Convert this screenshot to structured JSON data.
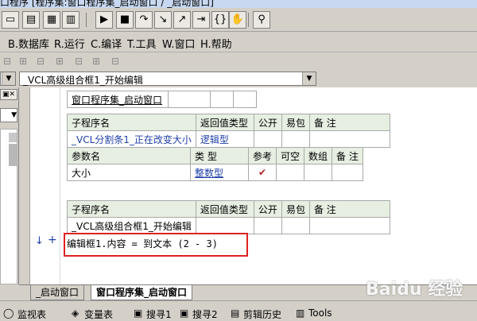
{
  "titlebar": {
    "text": "口程序 [程序集:窗口程序集_启动窗口 / _启动窗口]"
  },
  "menubar": {
    "items": [
      "B.数据库",
      "R.运行",
      "C.编译",
      "T.工具",
      "W.窗口",
      "H.帮助"
    ]
  },
  "combo": {
    "left_value": "",
    "right_value": "_VCL高级组合框1_开始编辑"
  },
  "table1": {
    "cells": [
      "窗口程序集_启动窗口",
      "",
      "",
      ""
    ]
  },
  "table2": {
    "header": [
      "子程序名",
      "返回值类型",
      "公开",
      "易包",
      "备 注"
    ],
    "row": [
      "_VCL分割条1_正在改变大小",
      "逻辑型",
      "",
      "",
      ""
    ],
    "param_header": [
      "参数名",
      "类 型",
      "参考",
      "可空",
      "数组",
      "备 注"
    ],
    "param_row": [
      "大小",
      "整数型",
      "✔",
      "",
      "",
      ""
    ]
  },
  "table3": {
    "header": [
      "子程序名",
      "返回值类型",
      "公开",
      "易包",
      "备 注"
    ],
    "row": [
      "_VCL高级组合框1_开始编辑",
      "",
      "",
      "",
      ""
    ]
  },
  "code": {
    "line": "编辑框1.内容 = 到文本 (2 - 3)"
  },
  "editor_tabs": [
    "_启动窗口",
    "窗口程序集_启动窗口"
  ],
  "bottom_tabs": [
    "监视表",
    "变量表",
    "搜寻1",
    "搜寻2",
    "剪辑历史",
    "Tools"
  ],
  "watermark": "Baidu 经验",
  "colors": {
    "accent_red": "#e02020",
    "type_blue": "#1f3fa8",
    "header_green": "#e6efe1",
    "check_red": "#b02020"
  }
}
